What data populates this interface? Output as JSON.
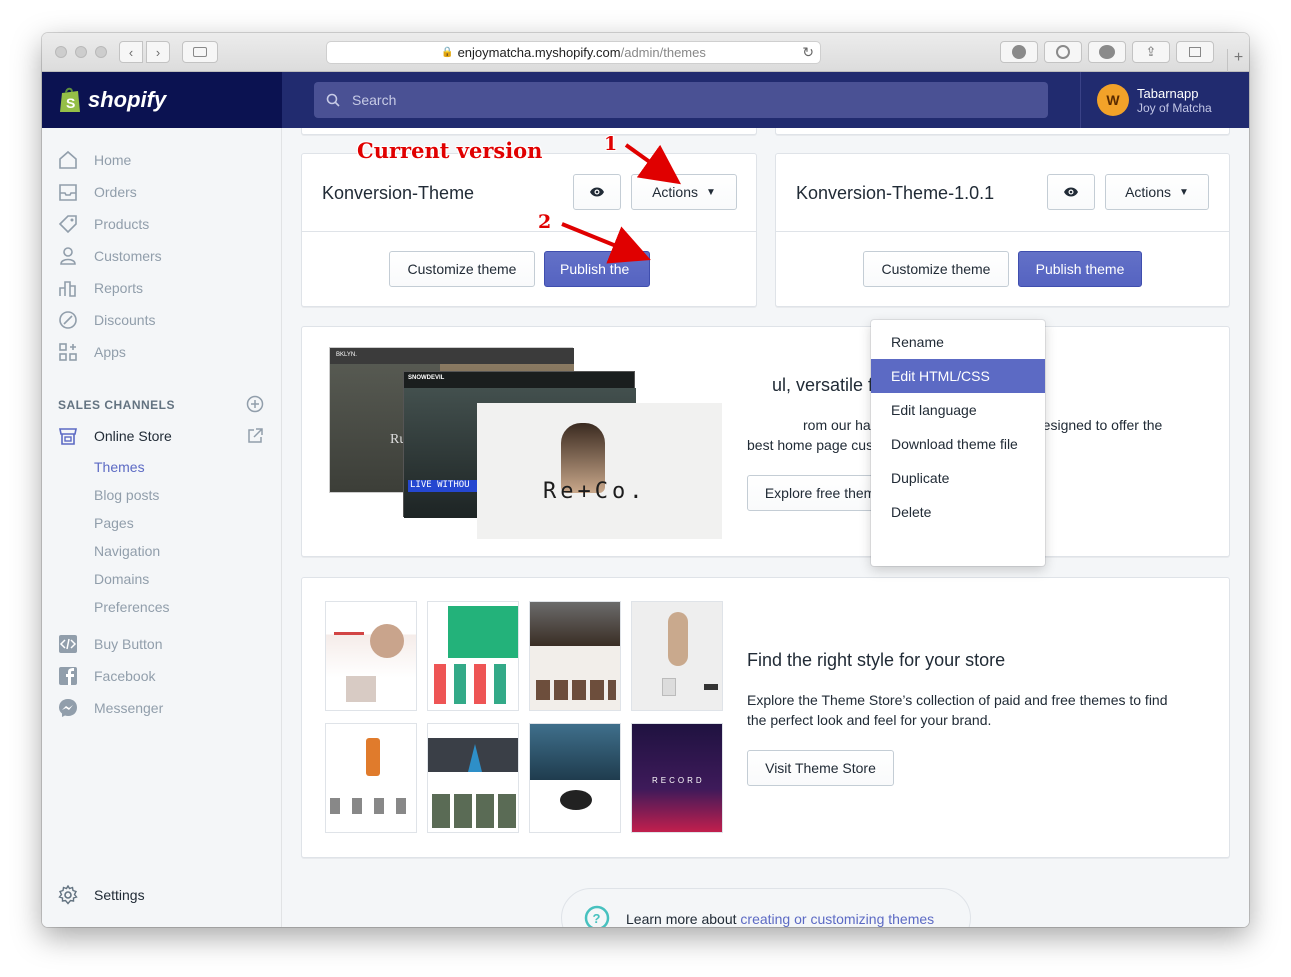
{
  "browser": {
    "url_host": "enjoymatcha.myshopify.com",
    "url_path": "/admin/themes"
  },
  "topbar": {
    "logo": "shopify",
    "search_placeholder": "Search",
    "user_name": "Tabarnapp",
    "store_name": "Joy of Matcha"
  },
  "sidebar": {
    "items": [
      {
        "label": "Home",
        "icon": "home-icon"
      },
      {
        "label": "Orders",
        "icon": "orders-icon"
      },
      {
        "label": "Products",
        "icon": "products-icon"
      },
      {
        "label": "Customers",
        "icon": "customers-icon"
      },
      {
        "label": "Reports",
        "icon": "reports-icon"
      },
      {
        "label": "Discounts",
        "icon": "discounts-icon"
      },
      {
        "label": "Apps",
        "icon": "apps-icon"
      }
    ],
    "sales_channels_heading": "SALES CHANNELS",
    "online_store_label": "Online Store",
    "online_store_subitems": [
      "Themes",
      "Blog posts",
      "Pages",
      "Navigation",
      "Domains",
      "Preferences"
    ],
    "other_channels": [
      "Buy Button",
      "Facebook",
      "Messenger"
    ],
    "settings_label": "Settings"
  },
  "themes": {
    "current": {
      "name": "Konversion-Theme",
      "actions_label": "Actions",
      "customize_label": "Customize theme",
      "publish_label": "Publish the"
    },
    "other": {
      "name": "Konversion-Theme-1.0.1",
      "actions_label": "Actions",
      "customize_label": "Customize theme",
      "publish_label": "Publish theme"
    }
  },
  "dropdown": {
    "items": [
      "Rename",
      "Edit HTML/CSS",
      "Edit language",
      "Download theme file",
      "Duplicate",
      "Delete"
    ],
    "active_index": 1
  },
  "annotations": {
    "current_version": "Current version",
    "step1": "1",
    "step2": "2"
  },
  "promo_free": {
    "title": "ul, versatile free themes",
    "text_line1": "rom our hand-picked free themes, all designed to offer the",
    "text_line2": "best home page customization for your store.",
    "button": "Explore free themes",
    "preview_labels": {
      "brand1": "BKLYN.",
      "brand2": "SNOWDEVIL",
      "banner": "LIVE WITHOU",
      "reco": "Re+Co.",
      "partial": "Ru"
    }
  },
  "promo_store": {
    "title": "Find the right style for your store",
    "text_line1": "Explore the Theme Store’s collection of paid and free themes to find",
    "text_line2": "the perfect look and feel for your brand.",
    "button": "Visit Theme Store",
    "thumb_labels": {
      "record": "RECORD"
    }
  },
  "footer": {
    "text": "Learn more about ",
    "link": "creating or customizing themes"
  },
  "colors": {
    "topbar": "#212b6f",
    "logo_bg": "#0b1251",
    "accent": "#5c6ac4",
    "annotation": "#e00000"
  }
}
